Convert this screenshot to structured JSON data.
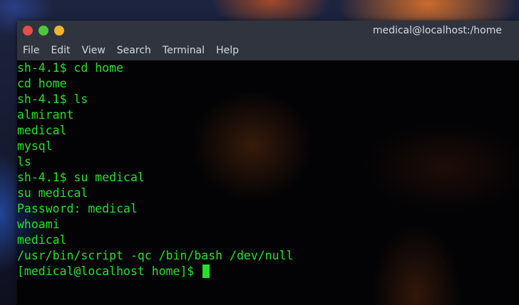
{
  "window": {
    "title": "medical@localhost:/home",
    "buttons": [
      "close",
      "maximize",
      "minimize"
    ]
  },
  "menubar": {
    "items": [
      "File",
      "Edit",
      "View",
      "Search",
      "Terminal",
      "Help"
    ]
  },
  "terminal": {
    "text_color": "#25e02a",
    "lines": [
      "sh-4.1$ cd home",
      "cd home",
      "sh-4.1$ ls",
      "almirant",
      "medical",
      "mysql",
      "ls",
      "sh-4.1$ su medical",
      "su medical",
      "Password: medical",
      "whoami",
      "medical",
      "/usr/bin/script -qc /bin/bash /dev/null"
    ],
    "prompt": "[medical@localhost home]$ "
  }
}
